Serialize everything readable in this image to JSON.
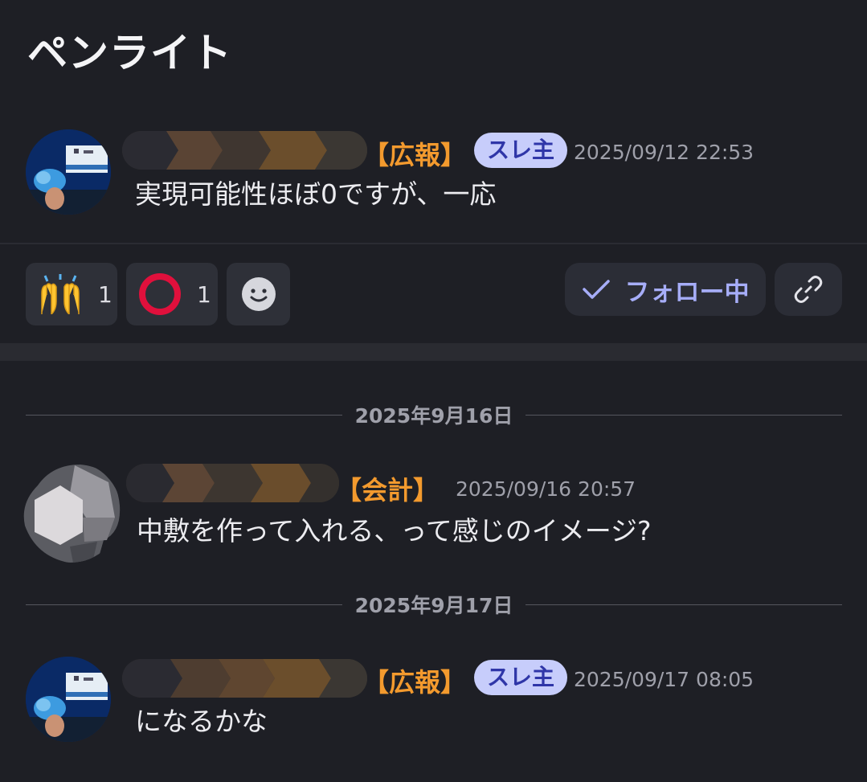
{
  "page": {
    "title": "ペンライト"
  },
  "posts": [
    {
      "role": "【広報】",
      "badge": "スレ主",
      "timestamp": "2025/09/12 22:53",
      "message": "実現可能性ほぼ0ですが、一応"
    },
    {
      "role": "【会計】",
      "timestamp": "2025/09/16 20:57",
      "message": "中敷を作って入れる、って感じのイメージ?"
    },
    {
      "role": "【広報】",
      "badge": "スレ主",
      "timestamp": "2025/09/17 08:05",
      "message": "になるかな"
    }
  ],
  "reactions": [
    {
      "icon": "raising-hands-icon",
      "count": "1"
    },
    {
      "icon": "red-circle-icon",
      "count": "1"
    },
    {
      "icon": "add-reaction-icon"
    }
  ],
  "actions": {
    "follow_label": "フォロー中",
    "link_icon": "link-icon"
  },
  "date_separators": [
    {
      "label": "2025年9月16日"
    },
    {
      "label": "2025年9月17日"
    }
  ],
  "colors": {
    "background": "#1e1f25",
    "role_accent": "#f39a2e",
    "badge_bg": "#c7cdfb",
    "badge_text": "#2f36a8",
    "follow_text": "#a6adf8"
  }
}
